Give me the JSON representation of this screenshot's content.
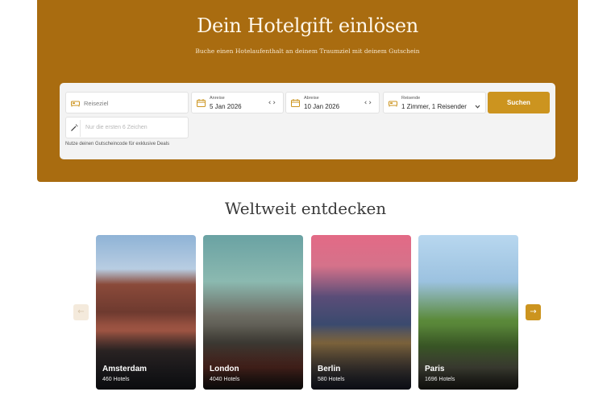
{
  "hero": {
    "title": "Dein Hotelgift einlösen",
    "subtitle": "Buche einen Hotelaufenthalt an deinem Traumziel mit deinem Gutschein"
  },
  "search": {
    "destination_placeholder": "Reiseziel",
    "checkin_label": "Anreise",
    "checkin_value": "5 Jan 2026",
    "checkout_label": "Abreise",
    "checkout_value": "10 Jan 2026",
    "guests_label": "Reisende",
    "guests_value": "1 Zimmer, 1 Reisender",
    "search_button": "Suchen",
    "code_placeholder": "Nur die ersten 6 Zeichen",
    "hint": "Nutze deinen Gutscheincode für exklusive Deals"
  },
  "discover": {
    "title": "Weltweit entdecken",
    "cities": [
      {
        "name": "Amsterdam",
        "hotels": "460 Hotels"
      },
      {
        "name": "London",
        "hotels": "4040 Hotels"
      },
      {
        "name": "Berlin",
        "hotels": "580 Hotels"
      },
      {
        "name": "Paris",
        "hotels": "1696 Hotels"
      }
    ]
  },
  "colors": {
    "hero_bg": "#a96c10",
    "accent": "#cc941f",
    "panel_bg": "#f3f3f3"
  },
  "icons": {
    "destination": "bed-icon",
    "checkin": "calendar-icon",
    "checkout": "calendar-icon",
    "guests": "bed-icon",
    "code": "magic-wand-icon",
    "date_stepper": "chevron-left-right-icon",
    "guests_dropdown": "chevron-down-icon",
    "prev": "arrow-left-icon",
    "next": "arrow-right-icon"
  }
}
